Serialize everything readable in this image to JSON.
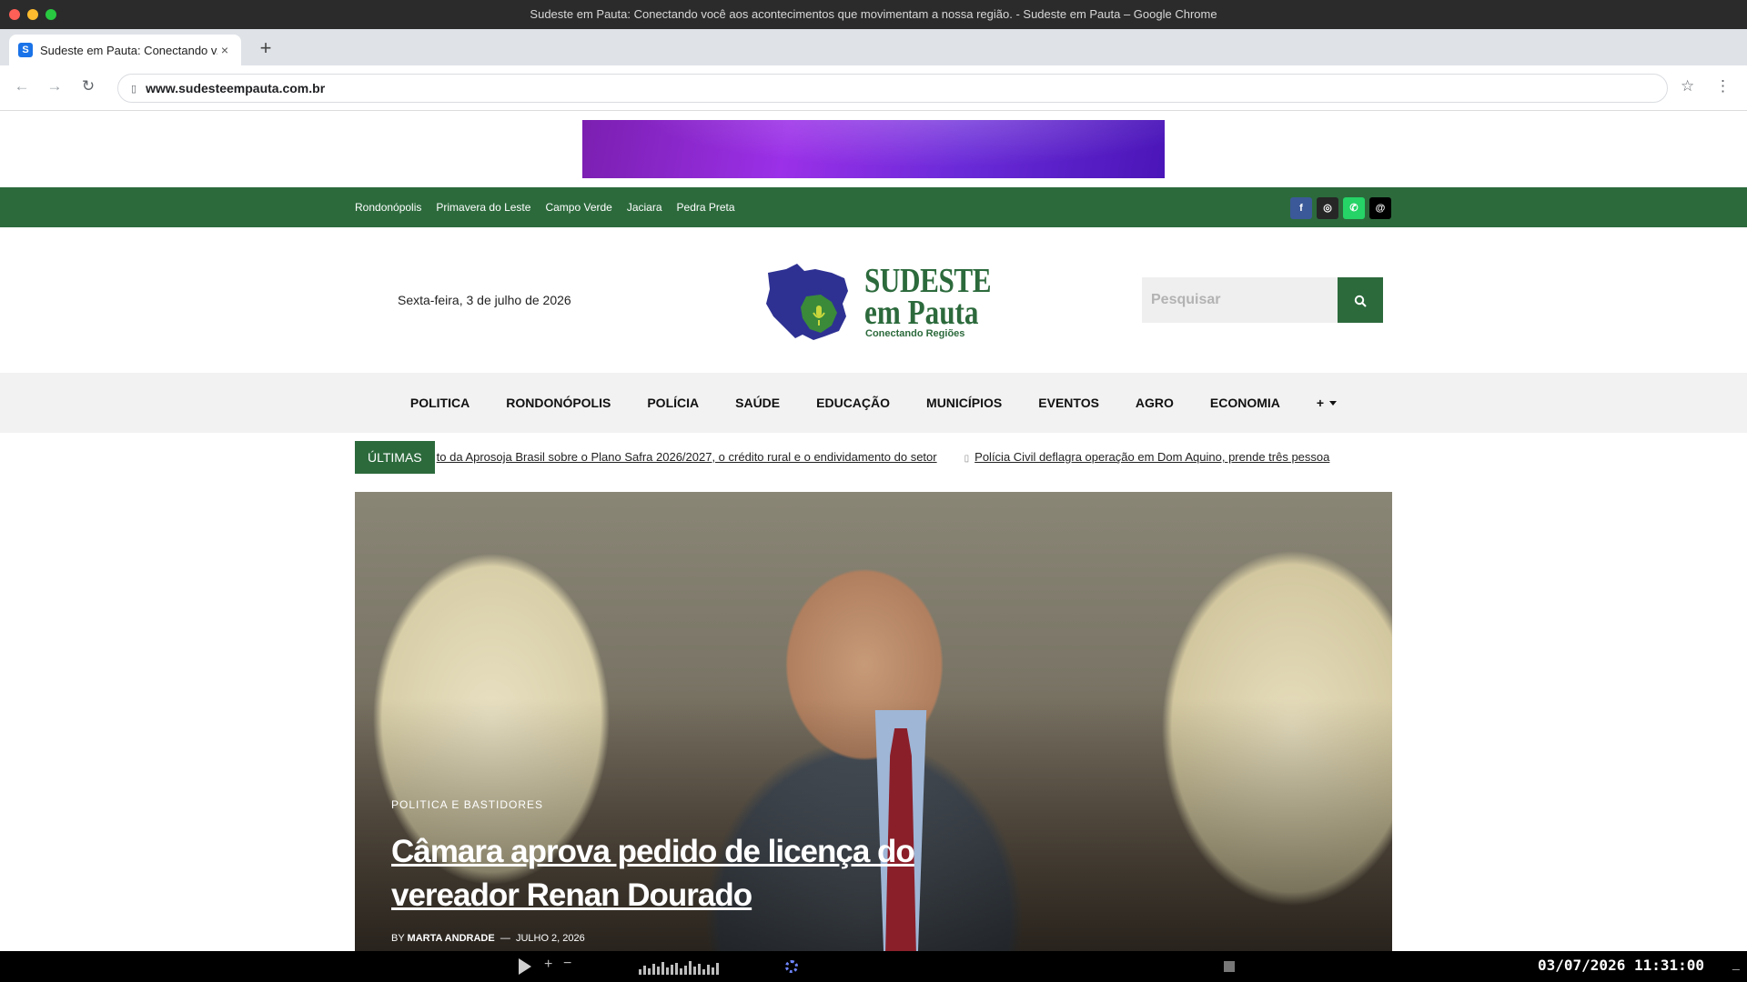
{
  "browser": {
    "window_title": "Sudeste em Pauta: Conectando você aos acontecimentos que movimentam a nossa região. - Sudeste em Pauta – Google Chrome",
    "tab_title": "Sudeste em Pauta: Conectando v...",
    "favicon_letter": "S",
    "tab_close": "×",
    "new_tab": "+",
    "url": "www.sudesteempauta.com.br",
    "icons": {
      "back": "←",
      "forward": "→",
      "reload": "↻",
      "star": "☆",
      "menu": "⋮",
      "lock": "🔒"
    }
  },
  "topbar": {
    "cities": [
      "Rondonópolis",
      "Primavera do Leste",
      "Campo Verde",
      "Jaciara",
      "Pedra Preta"
    ],
    "socials": [
      {
        "name": "facebook-icon",
        "glyph": "f"
      },
      {
        "name": "instagram-icon",
        "glyph": "◎"
      },
      {
        "name": "whatsapp-icon",
        "glyph": "✆"
      },
      {
        "name": "threads-icon",
        "glyph": "@"
      }
    ]
  },
  "header": {
    "date": "Sexta-feira, 3 de julho de 2026",
    "logo_line1": "SUDESTE",
    "logo_line2": "em Pauta",
    "logo_tagline": "Conectando Regiões",
    "search_placeholder": "Pesquisar",
    "colors": {
      "brand_green": "#2c6a3c",
      "map_blue": "#2e3192"
    }
  },
  "nav": {
    "items": [
      "POLITICA",
      "RONDONÓPOLIS",
      "POLÍCIA",
      "SAÚDE",
      "EDUCAÇÃO",
      "MUNICÍPIOS",
      "EVENTOS",
      "AGRO",
      "ECONOMIA"
    ],
    "more_label": "+"
  },
  "ticker": {
    "label": "ÚLTIMAS",
    "items": [
      "to da Aprosoja Brasil sobre o Plano Safra 2026/2027, o crédito rural e o endividamento do setor",
      "Polícia Civil deflagra operação em Dom Aquino, prende três pessoa"
    ]
  },
  "hero": {
    "category": "POLITICA E BASTIDORES",
    "title": "Câmara aprova pedido de licença do vereador Renan Dourado",
    "by_label": "BY",
    "author": "MARTA ANDRADE",
    "separator": "—",
    "date": "JULHO 2, 2026"
  },
  "taskbar": {
    "plus": "+",
    "minus": "−",
    "clock": "03/07/2026 11:31:00",
    "end": "_"
  }
}
